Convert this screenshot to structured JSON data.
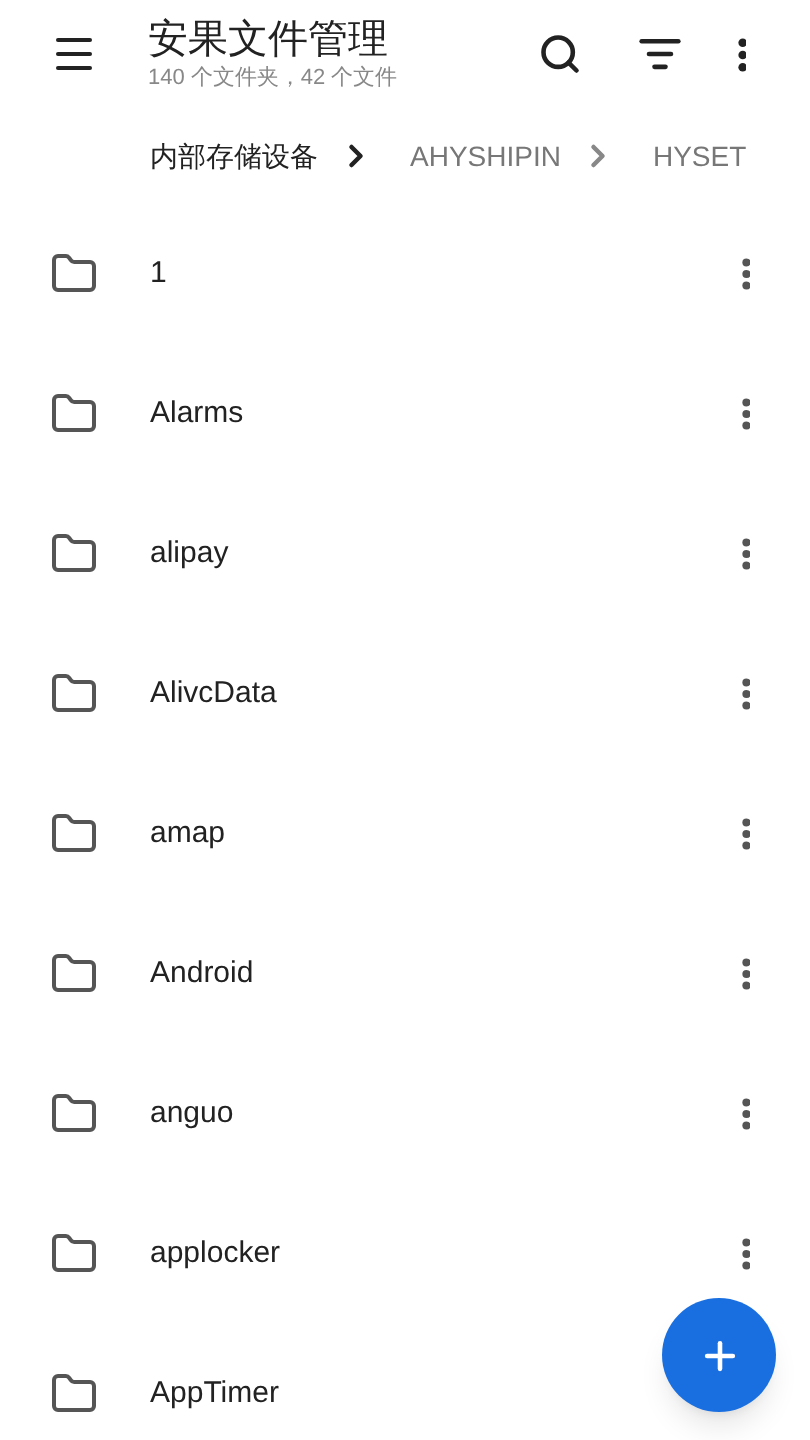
{
  "app_bar": {
    "title": "安果文件管理",
    "subtitle": "140 个文件夹，42 个文件"
  },
  "breadcrumbs": [
    {
      "label": "内部存储设备",
      "selected": true
    },
    {
      "label": "AHYSHIPIN",
      "selected": false
    },
    {
      "label": "HYSET",
      "selected": false
    }
  ],
  "folders": [
    {
      "name": "1"
    },
    {
      "name": "Alarms"
    },
    {
      "name": "alipay"
    },
    {
      "name": "AlivcData"
    },
    {
      "name": "amap"
    },
    {
      "name": "Android"
    },
    {
      "name": "anguo"
    },
    {
      "name": "applocker"
    },
    {
      "name": "AppTimer"
    }
  ]
}
